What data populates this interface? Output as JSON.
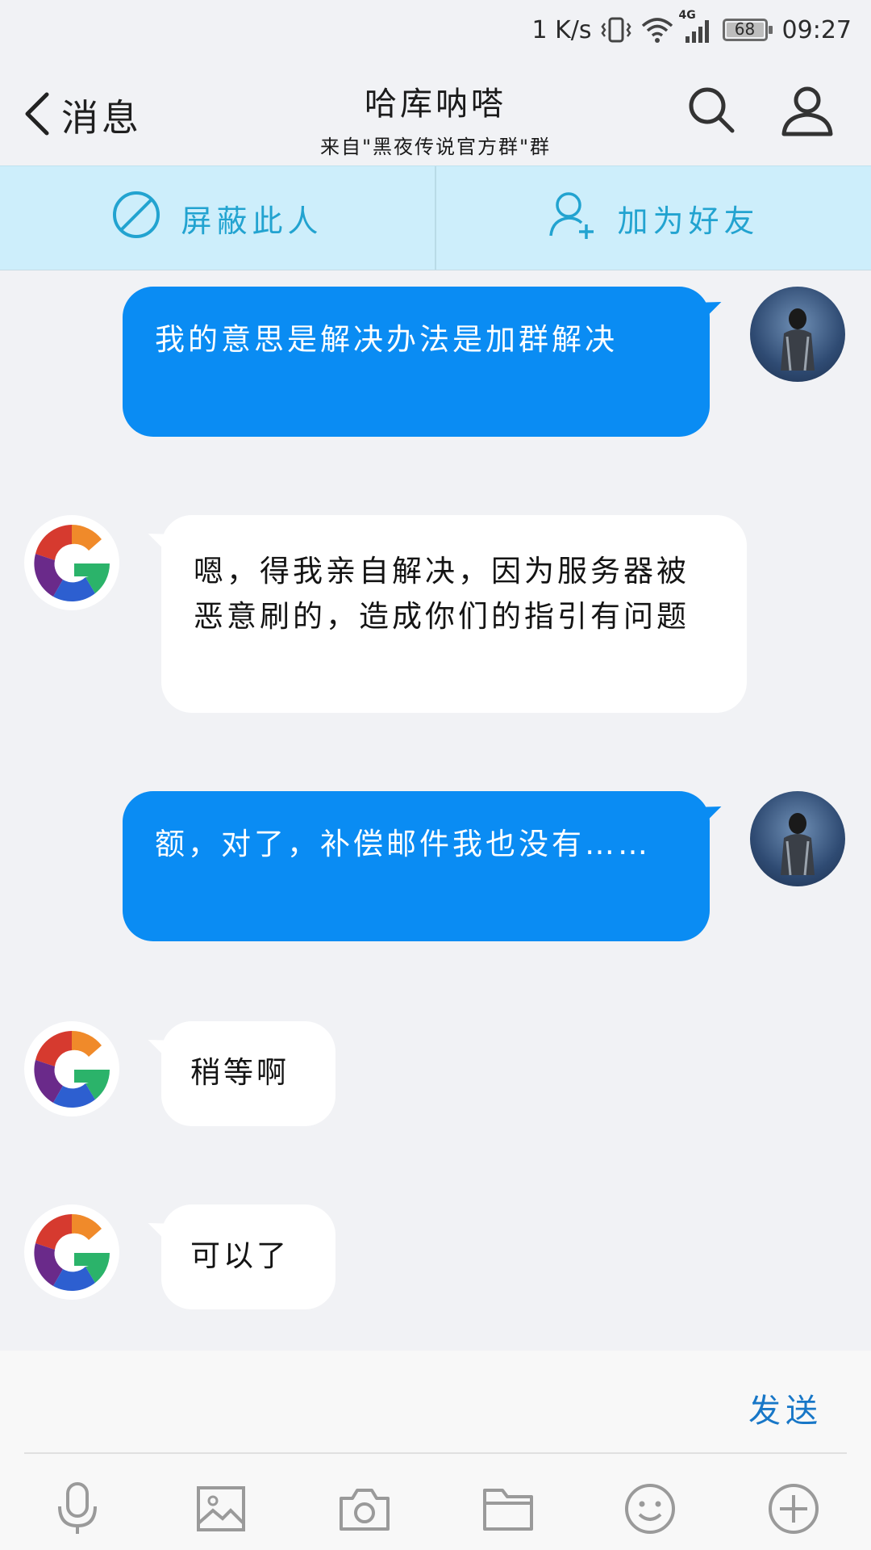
{
  "status_bar": {
    "speed": "1 K/s",
    "network": "4G",
    "battery": "68",
    "time": "09:27"
  },
  "header": {
    "back_label": "消息",
    "title": "哈库呐嗒",
    "subtitle": "来自\"黑夜传说官方群\"群"
  },
  "actions": {
    "block_label": "屏蔽此人",
    "add_friend_label": "加为好友"
  },
  "messages": [
    {
      "side": "right",
      "text": "我的意思是解决办法是加群解决"
    },
    {
      "side": "left",
      "text": "嗯，得我亲自解决，因为服务器被恶意刷的，造成你们的指引有问题"
    },
    {
      "side": "right",
      "text": "额，对了，补偿邮件我也没有……"
    },
    {
      "side": "left",
      "text": "稍等啊"
    },
    {
      "side": "left",
      "text": "可以了"
    }
  ],
  "composer": {
    "value": "",
    "placeholder": "",
    "send_label": "发送"
  },
  "toolbar_icons": [
    "mic-icon",
    "image-icon",
    "camera-icon",
    "folder-icon",
    "emoji-icon",
    "plus-icon"
  ],
  "colors": {
    "accent_blue": "#0a8cf3",
    "action_bar_bg": "#cdeefb",
    "action_text": "#22a3d0",
    "send": "#1877c7",
    "background": "#f1f2f5"
  }
}
